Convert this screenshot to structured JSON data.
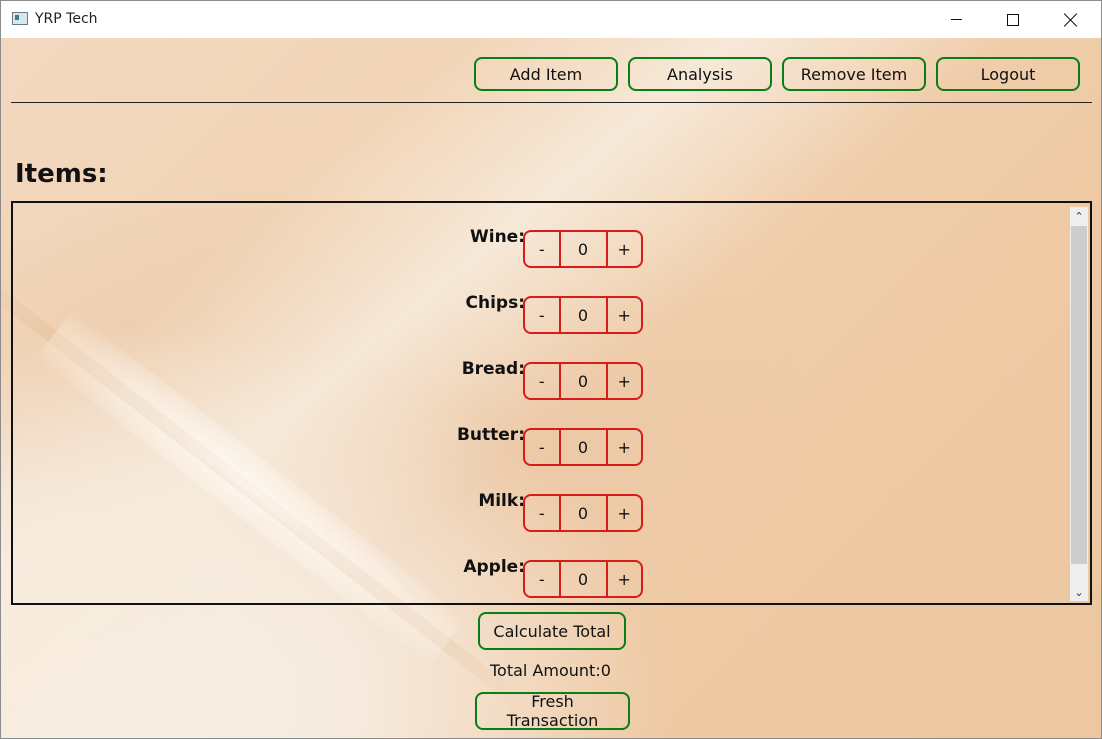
{
  "window": {
    "title": "YRP Tech",
    "controls": {
      "minimize": "minimize-icon",
      "maximize": "maximize-icon",
      "close": "close-icon"
    }
  },
  "toolbar": {
    "buttons": [
      {
        "label": "Add Item"
      },
      {
        "label": "Analysis"
      },
      {
        "label": "Remove Item"
      },
      {
        "label": "Logout"
      }
    ]
  },
  "items_section": {
    "heading": "Items:",
    "items": [
      {
        "label": "Wine:",
        "minus": "-",
        "quantity": "0",
        "plus": "+"
      },
      {
        "label": "Chips:",
        "minus": "-",
        "quantity": "0",
        "plus": "+"
      },
      {
        "label": "Bread:",
        "minus": "-",
        "quantity": "0",
        "plus": "+"
      },
      {
        "label": "Butter:",
        "minus": "-",
        "quantity": "0",
        "plus": "+"
      },
      {
        "label": "Milk:",
        "minus": "-",
        "quantity": "0",
        "plus": "+"
      },
      {
        "label": "Apple:",
        "minus": "-",
        "quantity": "0",
        "plus": "+"
      }
    ]
  },
  "footer": {
    "calculate_label": "Calculate Total",
    "total_text": "Total Amount:0",
    "fresh_label": "Fresh Transaction"
  },
  "colors": {
    "nav_border": "#0b7d16",
    "stepper_border": "#d81c1c",
    "background": "#f1d2b2"
  }
}
